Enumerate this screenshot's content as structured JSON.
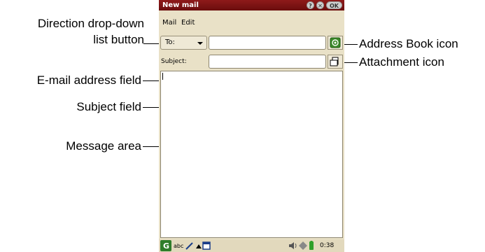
{
  "annotations": {
    "direction_dropdown_line1": "Direction drop-down",
    "direction_dropdown_line2": "list button",
    "email_address_field": "E-mail address field",
    "subject_field": "Subject field",
    "message_area": "Message area",
    "address_book_icon": "Address Book icon",
    "attachment_icon": "Attachment icon"
  },
  "window": {
    "title": "New mail",
    "help_glyph": "?",
    "close_glyph": "✕",
    "ok_label": "OK"
  },
  "menu": {
    "items": [
      "Mail",
      "Edit"
    ]
  },
  "compose": {
    "direction_value": "To:",
    "email_value": "",
    "subject_label": "Subject:",
    "subject_value": "",
    "message_body": ""
  },
  "status": {
    "input_mode": "abc",
    "clock": "0:38"
  },
  "colors": {
    "title_bar": "#7a1010",
    "screen_background": "#e9e1c7",
    "status_bar": "#e2d9bd",
    "address_book_icon": "#3c8a2a"
  },
  "icons": {
    "address_book": "address-book-icon",
    "attachment": "attachment-icon",
    "launcher": "launcher-icon",
    "pen": "pen-icon",
    "speaker": "speaker-icon",
    "battery": "battery-icon"
  }
}
